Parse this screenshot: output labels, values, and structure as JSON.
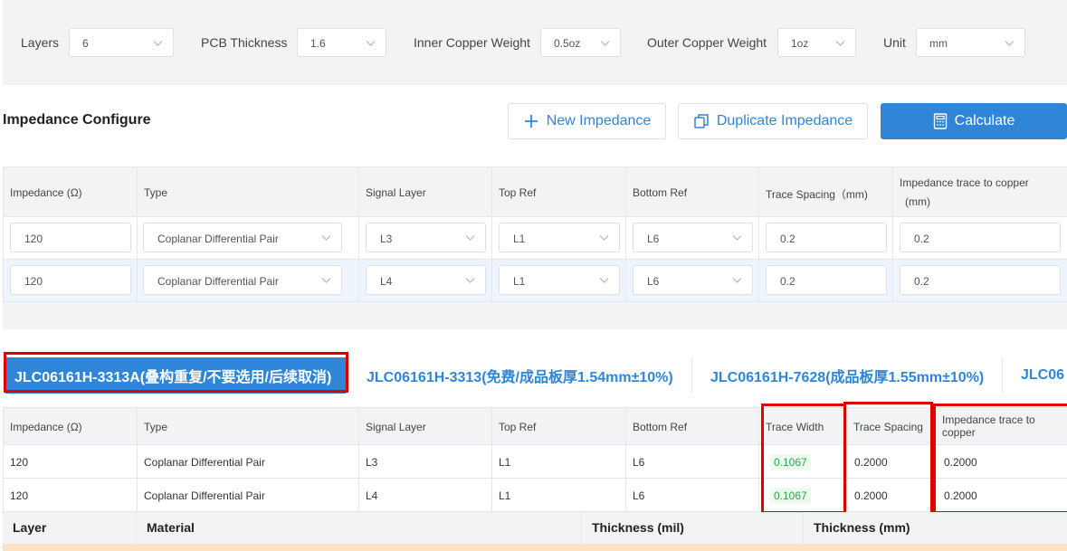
{
  "params": {
    "layers_label": "Layers",
    "layers_value": "6",
    "thickness_label": "PCB Thickness",
    "thickness_value": "1.6",
    "inner_label": "Inner Copper Weight",
    "inner_value": "0.5oz",
    "outer_label": "Outer Copper Weight",
    "outer_value": "1oz",
    "unit_label": "Unit",
    "unit_value": "mm"
  },
  "config": {
    "title": "Impedance Configure",
    "new_button": "New Impedance",
    "duplicate_button": "Duplicate Impedance",
    "calculate_button": "Calculate",
    "columns": [
      "Impedance (Ω)",
      "Type",
      "Signal Layer",
      "Top Ref",
      "Bottom Ref",
      "Trace Spacing（mm)",
      "Impedance trace to copper",
      "(mm)"
    ],
    "rows": [
      {
        "impedance": "120",
        "type": "Coplanar Differential Pair",
        "signal": "L3",
        "top": "L1",
        "bottom": "L6",
        "spacing": "0.2",
        "copper": "0.2"
      },
      {
        "impedance": "120",
        "type": "Coplanar Differential Pair",
        "signal": "L4",
        "top": "L1",
        "bottom": "L6",
        "spacing": "0.2",
        "copper": "0.2"
      }
    ]
  },
  "tabs": [
    "JLC06161H-3313A(叠构重复/不要选用/后续取消)",
    "JLC06161H-3313(免费/成品板厚1.54mm±10%)",
    "JLC06161H-7628(成品板厚1.55mm±10%)",
    "JLC06"
  ],
  "results": {
    "columns": [
      "Impedance (Ω)",
      "Type",
      "Signal Layer",
      "Top Ref",
      "Bottom Ref",
      "Trace Width",
      "Trace Spacing",
      "Impedance trace to",
      "copper"
    ],
    "rows": [
      {
        "impedance": "120",
        "type": "Coplanar Differential Pair",
        "signal": "L3",
        "top": "L1",
        "bottom": "L6",
        "width": "0.1067",
        "spacing": "0.2000",
        "copper": "0.2000"
      },
      {
        "impedance": "120",
        "type": "Coplanar Differential Pair",
        "signal": "L4",
        "top": "L1",
        "bottom": "L6",
        "width": "0.1067",
        "spacing": "0.2000",
        "copper": "0.2000"
      }
    ]
  },
  "layers_table": {
    "columns": [
      "Layer",
      "Material",
      "Thickness (mil)",
      "Thickness (mm)"
    ]
  },
  "colors": {
    "accent": "#2f86d8",
    "highlight_border": "#e00000",
    "success": "#28a745"
  }
}
